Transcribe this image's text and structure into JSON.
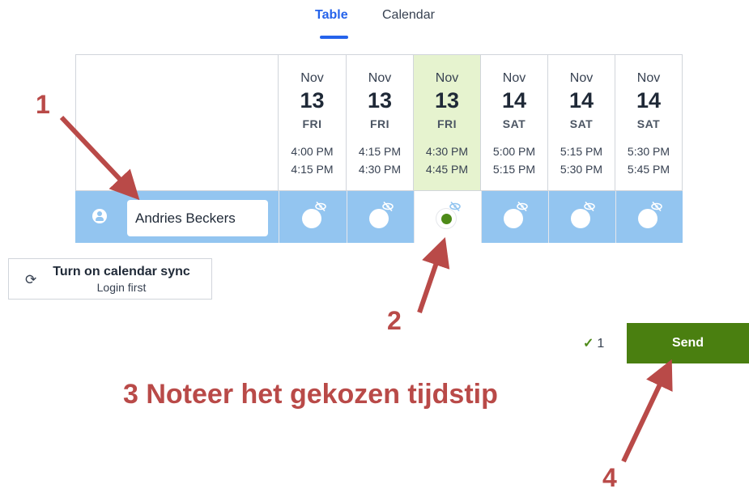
{
  "tabs": [
    {
      "label": "Table",
      "active": true
    },
    {
      "label": "Calendar",
      "active": false
    }
  ],
  "columns": [
    {
      "month": "Nov",
      "day": "13",
      "weekday": "FRI",
      "start": "4:00 PM",
      "end": "4:15 PM",
      "selected": false
    },
    {
      "month": "Nov",
      "day": "13",
      "weekday": "FRI",
      "start": "4:15 PM",
      "end": "4:30 PM",
      "selected": false
    },
    {
      "month": "Nov",
      "day": "13",
      "weekday": "FRI",
      "start": "4:30 PM",
      "end": "4:45 PM",
      "selected": true
    },
    {
      "month": "Nov",
      "day": "14",
      "weekday": "SAT",
      "start": "5:00 PM",
      "end": "5:15 PM",
      "selected": false
    },
    {
      "month": "Nov",
      "day": "14",
      "weekday": "SAT",
      "start": "5:15 PM",
      "end": "5:30 PM",
      "selected": false
    },
    {
      "month": "Nov",
      "day": "14",
      "weekday": "SAT",
      "start": "5:30 PM",
      "end": "5:45 PM",
      "selected": false
    }
  ],
  "participant": {
    "name": "Andries Beckers",
    "icon": "user-icon"
  },
  "sync": {
    "title": "Turn on calendar sync",
    "subtitle": "Login first",
    "icon": "sync-icon"
  },
  "selection_count": "1",
  "send_label": "Send",
  "annotations": {
    "one": "1",
    "two": "2",
    "three": "3 Noteer het gekozen tijdstip",
    "four": "4"
  },
  "colors": {
    "accent": "#2563eb",
    "row": "#93c5f0",
    "selected_col": "#e6f3cf",
    "send": "#4a7f10",
    "annotation": "#b94a48"
  }
}
